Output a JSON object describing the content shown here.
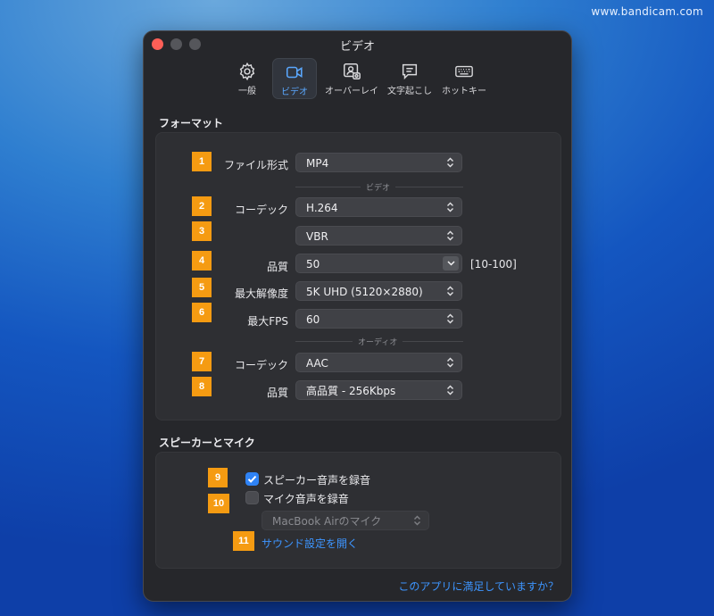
{
  "watermark": "www.bandicam.com",
  "window": {
    "title": "ビデオ"
  },
  "toolbar": {
    "tabs": [
      {
        "label": "一般",
        "icon": "gear-icon"
      },
      {
        "label": "ビデオ",
        "icon": "video-camera-icon",
        "active": true
      },
      {
        "label": "オーバーレイ",
        "icon": "overlay-camera-icon"
      },
      {
        "label": "文字起こし",
        "icon": "speech-bubble-icon"
      },
      {
        "label": "ホットキー",
        "icon": "keyboard-icon"
      }
    ]
  },
  "format": {
    "title": "フォーマット",
    "file_format_label": "ファイル形式",
    "file_format_value": "MP4",
    "video_divider": "ビデオ",
    "video_codec_label": "コーデック",
    "video_codec_value": "H.264",
    "bitrate_mode_value": "VBR",
    "quality_label": "品質",
    "quality_value": "50",
    "quality_range": "[10-100]",
    "max_resolution_label": "最大解像度",
    "max_resolution_value": "5K UHD (5120×2880)",
    "max_fps_label": "最大FPS",
    "max_fps_value": "60",
    "audio_divider": "オーディオ",
    "audio_codec_label": "コーデック",
    "audio_codec_value": "AAC",
    "audio_quality_label": "品質",
    "audio_quality_value": "高品質 - 256Kbps"
  },
  "speaker_mic": {
    "title": "スピーカーとマイク",
    "record_speaker_label": "スピーカー音声を録音",
    "record_speaker_checked": true,
    "record_mic_label": "マイク音声を録音",
    "record_mic_checked": false,
    "mic_device_value": "MacBook Airのマイク",
    "sound_settings_link": "サウンド設定を開く"
  },
  "badges": [
    "1",
    "2",
    "3",
    "4",
    "5",
    "6",
    "7",
    "8",
    "9",
    "10",
    "11"
  ],
  "footer": {
    "feedback_link": "このアプリに満足していますか？"
  },
  "colors": {
    "accent": "#3d95ff",
    "badge": "#f59b12",
    "checkbox_on": "#2f83f5"
  }
}
